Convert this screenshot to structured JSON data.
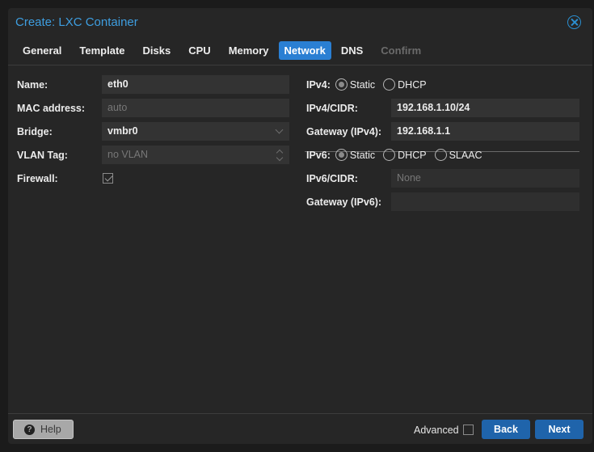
{
  "window": {
    "title": "Create: LXC Container",
    "close_icon": "close-circle-icon"
  },
  "tabs": [
    {
      "label": "General",
      "state": "normal"
    },
    {
      "label": "Template",
      "state": "normal"
    },
    {
      "label": "Disks",
      "state": "normal"
    },
    {
      "label": "CPU",
      "state": "normal"
    },
    {
      "label": "Memory",
      "state": "normal"
    },
    {
      "label": "Network",
      "state": "active"
    },
    {
      "label": "DNS",
      "state": "normal"
    },
    {
      "label": "Confirm",
      "state": "disabled"
    }
  ],
  "left": {
    "name": {
      "label": "Name:",
      "value": "eth0"
    },
    "mac": {
      "label": "MAC address:",
      "placeholder": "auto"
    },
    "bridge": {
      "label": "Bridge:",
      "value": "vmbr0"
    },
    "vlan": {
      "label": "VLAN Tag:",
      "placeholder": "no VLAN"
    },
    "firewall": {
      "label": "Firewall:",
      "checked": true
    }
  },
  "right": {
    "ipv4": {
      "label": "IPv4:",
      "options": [
        "Static",
        "DHCP"
      ],
      "selected": "Static"
    },
    "ipv4_cidr": {
      "label": "IPv4/CIDR:",
      "value": "192.168.1.10/24"
    },
    "gateway4": {
      "label": "Gateway (IPv4):",
      "value": "192.168.1.1"
    },
    "ipv6": {
      "label": "IPv6:",
      "options": [
        "Static",
        "DHCP",
        "SLAAC"
      ],
      "selected": "Static"
    },
    "ipv6_cidr": {
      "label": "IPv6/CIDR:",
      "placeholder": "None"
    },
    "gateway6": {
      "label": "Gateway (IPv6):",
      "value": ""
    }
  },
  "footer": {
    "help_label": "Help",
    "advanced_label": "Advanced",
    "advanced_checked": false,
    "back_label": "Back",
    "next_label": "Next"
  }
}
